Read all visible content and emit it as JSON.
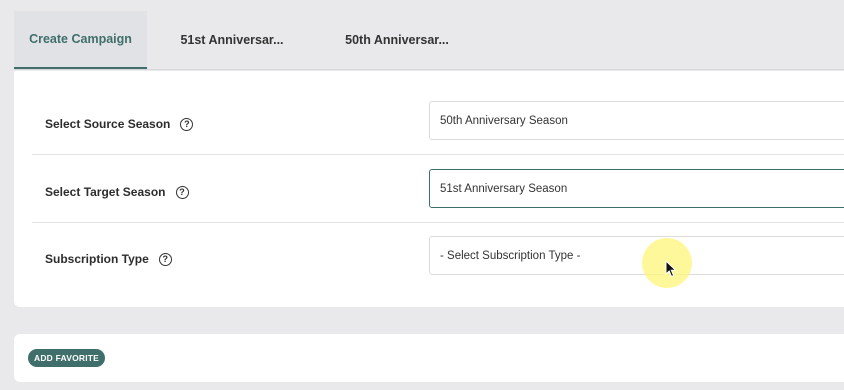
{
  "tabs": [
    {
      "label": "Create Campaign",
      "active": true
    },
    {
      "label": "51st Anniversar..."
    },
    {
      "label": "50th Anniversar..."
    }
  ],
  "form": {
    "source_season": {
      "label": "Select Source Season",
      "value": "50th Anniversary Season"
    },
    "target_season": {
      "label": "Select Target Season",
      "value": "51st Anniversary Season"
    },
    "subscription_type": {
      "label": "Subscription Type",
      "value": "- Select Subscription Type -"
    },
    "help_glyph": "?"
  },
  "favorites": {
    "button_label": "ADD FAVORITE"
  },
  "colors": {
    "accent": "#3f6e6b",
    "background": "#e9e9ec",
    "card": "#ffffff",
    "cursor_highlight": "#fff578"
  }
}
